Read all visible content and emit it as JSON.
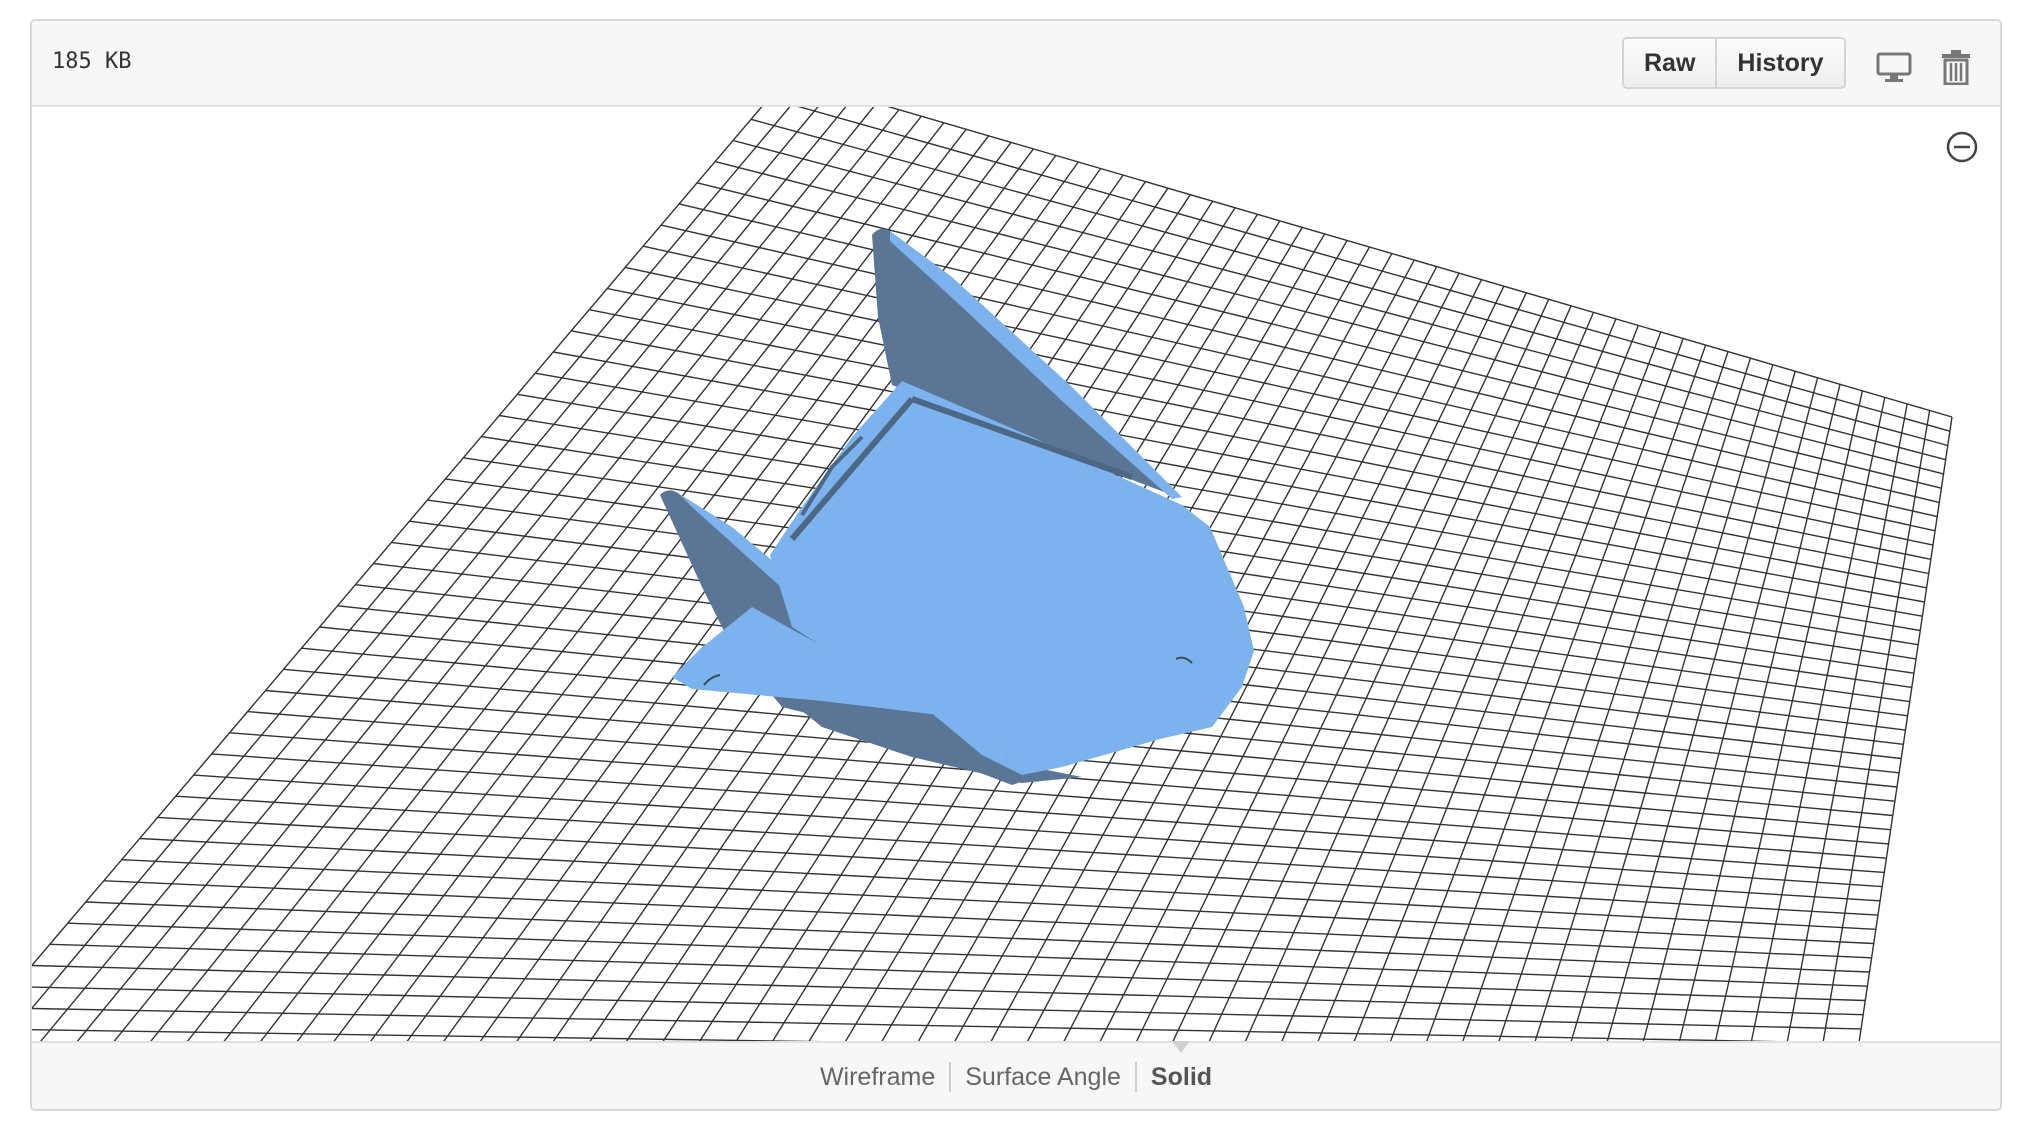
{
  "header": {
    "file_size": "185 KB",
    "buttons": {
      "raw": "Raw",
      "history": "History"
    },
    "icons": {
      "display": "desktop-display-icon",
      "delete": "trash-icon"
    }
  },
  "viewer": {
    "zoom_icon": "zoom-out-icon",
    "model_color": "#7cb3ee",
    "model_shadow_color": "#5b7594",
    "grid_color": "#333333"
  },
  "modes": {
    "items": [
      "Wireframe",
      "Surface Angle",
      "Solid"
    ],
    "active": "Solid"
  }
}
